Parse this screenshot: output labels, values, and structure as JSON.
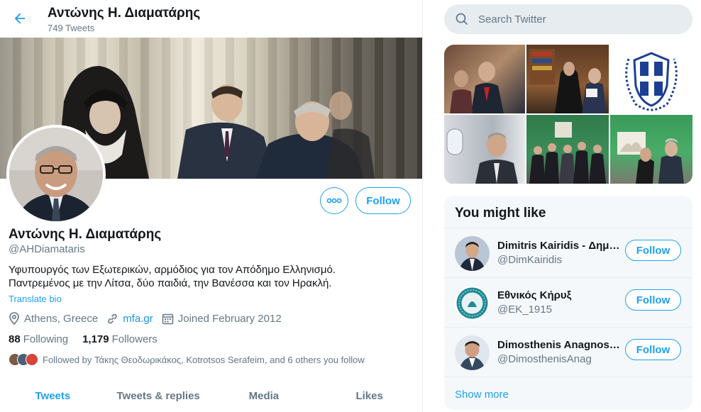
{
  "header": {
    "name": "Αντώνης Η. Διαματάρης",
    "tweet_count": "749 Tweets"
  },
  "profile": {
    "name": "Αντώνης Η. Διαματάρης",
    "handle": "@AHDiamataris",
    "bio_line1": "Υφυπουργός των Εξωτερικών, αρμόδιος για τον Απόδημο Ελληνισμό.",
    "bio_line2": "Παντρεμένος με την Λίτσα, δύο παιδιά, την Βανέσσα και τον Ηρακλή.",
    "translate_label": "Translate bio",
    "location": "Athens, Greece",
    "website": "mfa.gr",
    "joined": "Joined February 2012",
    "following_count": "88",
    "following_label": "Following",
    "followers_count": "1,179",
    "followers_label": "Followers",
    "followed_by": "Followed by Τάκης Θεοδωρικάκος, Kotrotsos Serafeim, and 6 others you follow",
    "follow_label": "Follow"
  },
  "tabs": [
    {
      "label": "Tweets"
    },
    {
      "label": "Tweets & replies"
    },
    {
      "label": "Media"
    },
    {
      "label": "Likes"
    }
  ],
  "sidebar": {
    "search_placeholder": "Search Twitter",
    "suggest_title": "You might like",
    "suggestions": [
      {
        "name": "Dimitris Kairidis - Δημήτρης Καιρίδης",
        "handle": "@DimKairidis",
        "button": "Follow"
      },
      {
        "name": "Εθνικός Κήρυξ",
        "handle": "@EK_1915",
        "button": "Follow"
      },
      {
        "name": "Dimosthenis Anagnostopoulos",
        "handle": "@DimosthenisAnag",
        "button": "Follow"
      }
    ],
    "show_more": "Show more"
  },
  "colors": {
    "accent": "#1da1f2",
    "text_secondary": "#657786",
    "panel_bg": "#f5f8fa"
  }
}
